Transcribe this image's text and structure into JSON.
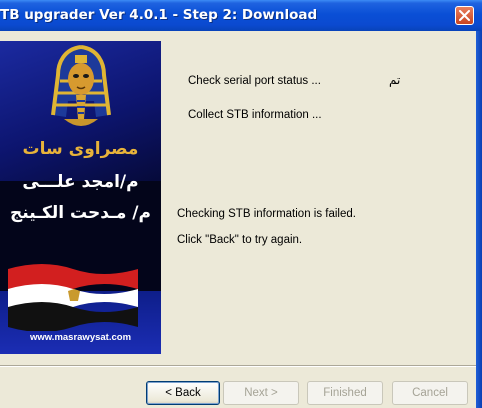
{
  "window": {
    "title": "TB upgrader Ver 4.0.1 - Step 2: Download",
    "close_icon": "close-icon",
    "accent": "#0a4fd6"
  },
  "banner": {
    "line1": "مصراوى سات",
    "line2": "م/امجد علـــى",
    "line3": "م/ مـدحت الكـينج",
    "website": "www.masrawysat.com",
    "icons": [
      "pharaoh-mask-icon",
      "egypt-flag-icon"
    ]
  },
  "status": {
    "step1_text": "Check serial port status ...",
    "step1_result": "تم",
    "step2_text": "Collect STB information ...",
    "error_text": "Checking STB information is failed.",
    "hint_text": "Click \"Back\" to try again."
  },
  "buttons": {
    "back": "< Back",
    "next": "Next >",
    "finished": "Finished",
    "cancel": "Cancel"
  }
}
